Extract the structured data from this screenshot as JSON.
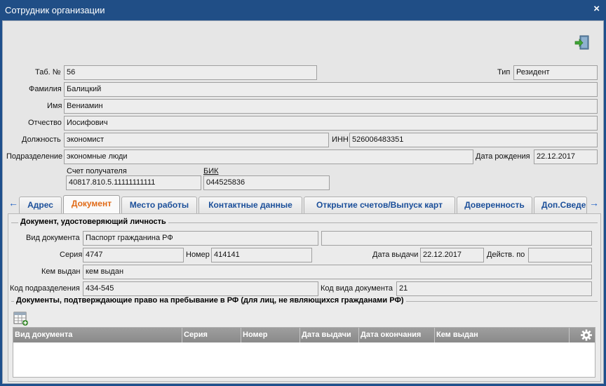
{
  "window": {
    "title": "Сотрудник организации",
    "close_glyph": "×"
  },
  "icons": {
    "exit": "exit-door-icon",
    "add_document": "table-add-icon",
    "settings": "gear-icon",
    "tab_prev": "arrow-left-icon",
    "tab_next": "arrow-right-icon"
  },
  "header_form": {
    "tab_no": {
      "label": "Таб. №",
      "value": "56"
    },
    "type": {
      "label": "Тип",
      "value": "Резидент"
    },
    "surname": {
      "label": "Фамилия",
      "value": "Балицкий"
    },
    "name": {
      "label": "Имя",
      "value": "Вениамин"
    },
    "patronymic": {
      "label": "Отчество",
      "value": "Иосифович"
    },
    "position": {
      "label": "Должность",
      "value": "экономист"
    },
    "inn": {
      "label": "ИНН",
      "value": "526006483351"
    },
    "department": {
      "label": "Подразделение",
      "value": "экономные люди"
    },
    "birth_date": {
      "label": "Дата рождения",
      "value": "22.12.2017"
    },
    "account": {
      "label": "Счет получателя",
      "value": "40817.810.5.11111111111"
    },
    "bik": {
      "label": "БИК",
      "value": "044525836"
    }
  },
  "tabs": {
    "prev": "←",
    "next": "→",
    "items": [
      {
        "label": "Адрес",
        "active": false
      },
      {
        "label": "Документ",
        "active": true
      },
      {
        "label": "Место работы",
        "active": false
      },
      {
        "label": "Контактные данные",
        "active": false
      },
      {
        "label": "Открытие счетов/Выпуск карт",
        "active": false
      },
      {
        "label": "Доверенность",
        "active": false
      },
      {
        "label": "Доп.Сведе",
        "active": false
      }
    ]
  },
  "document": {
    "section_title": "Документ, удостоверяющий личность",
    "doc_type": {
      "label": "Вид документа",
      "value": "Паспорт гражданина РФ",
      "extra": ""
    },
    "series": {
      "label": "Серия",
      "value": "4747"
    },
    "number": {
      "label": "Номер",
      "value": "414141"
    },
    "issue_date": {
      "label": "Дата выдачи",
      "value": "22.12.2017"
    },
    "valid_to": {
      "label": "Действ. по",
      "value": ""
    },
    "issued_by": {
      "label": "Кем выдан",
      "value": "кем выдан"
    },
    "dept_code": {
      "label": "Код подразделения",
      "value": "434-545"
    },
    "doc_type_code": {
      "label": "Код вида документа",
      "value": "21"
    }
  },
  "residence": {
    "section_title": "Документы, подтверждающие право на пребывание в РФ (для лиц, не являющихся гражданами РФ)",
    "columns": [
      "Вид документа",
      "Серия",
      "Номер",
      "Дата выдачи",
      "Дата окончания",
      "Кем выдан"
    ],
    "rows": []
  }
}
